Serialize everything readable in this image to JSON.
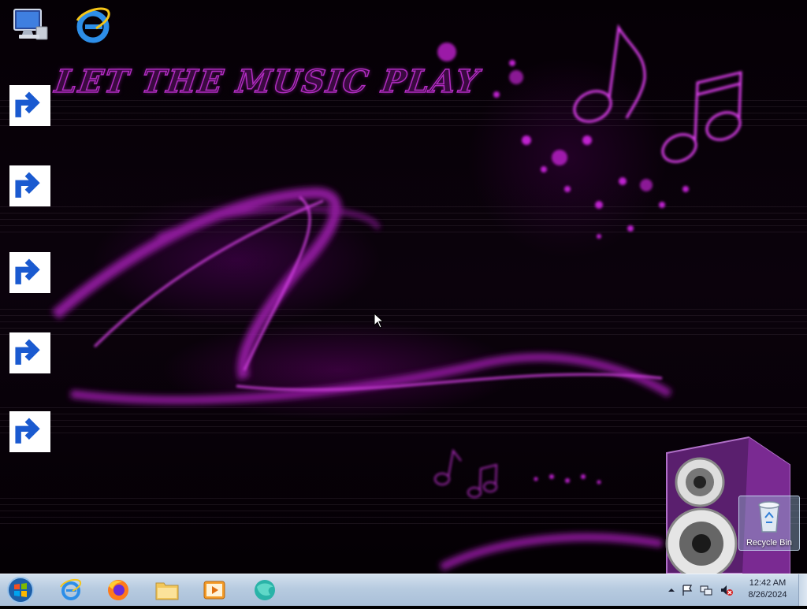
{
  "wallpaper": {
    "title": "LET THE MUSIC PLAY"
  },
  "desktop_icons": [
    {
      "name": "computer-icon",
      "shortcut": false
    },
    {
      "name": "internet-explorer-icon",
      "shortcut": false
    },
    {
      "name": "firefox-icon",
      "shortcut": true
    },
    {
      "name": "globe-browser-icon",
      "shortcut": true
    },
    {
      "name": "visual-studio-icon",
      "shortcut": true
    },
    {
      "name": "notepad-plus-plus-icon",
      "shortcut": true
    },
    {
      "name": "ring-app-icon",
      "shortcut": true
    }
  ],
  "recycle_bin": {
    "label": "Recycle Bin"
  },
  "taskbar": {
    "pinned": [
      "internet-explorer",
      "firefox",
      "file-explorer",
      "media-player",
      "globe-browser"
    ]
  },
  "tray": {
    "time": "12:42 AM",
    "date": "8/26/2024"
  },
  "colors": {
    "accent": "#b02cc0",
    "taskbar": "#b7cbe0"
  }
}
